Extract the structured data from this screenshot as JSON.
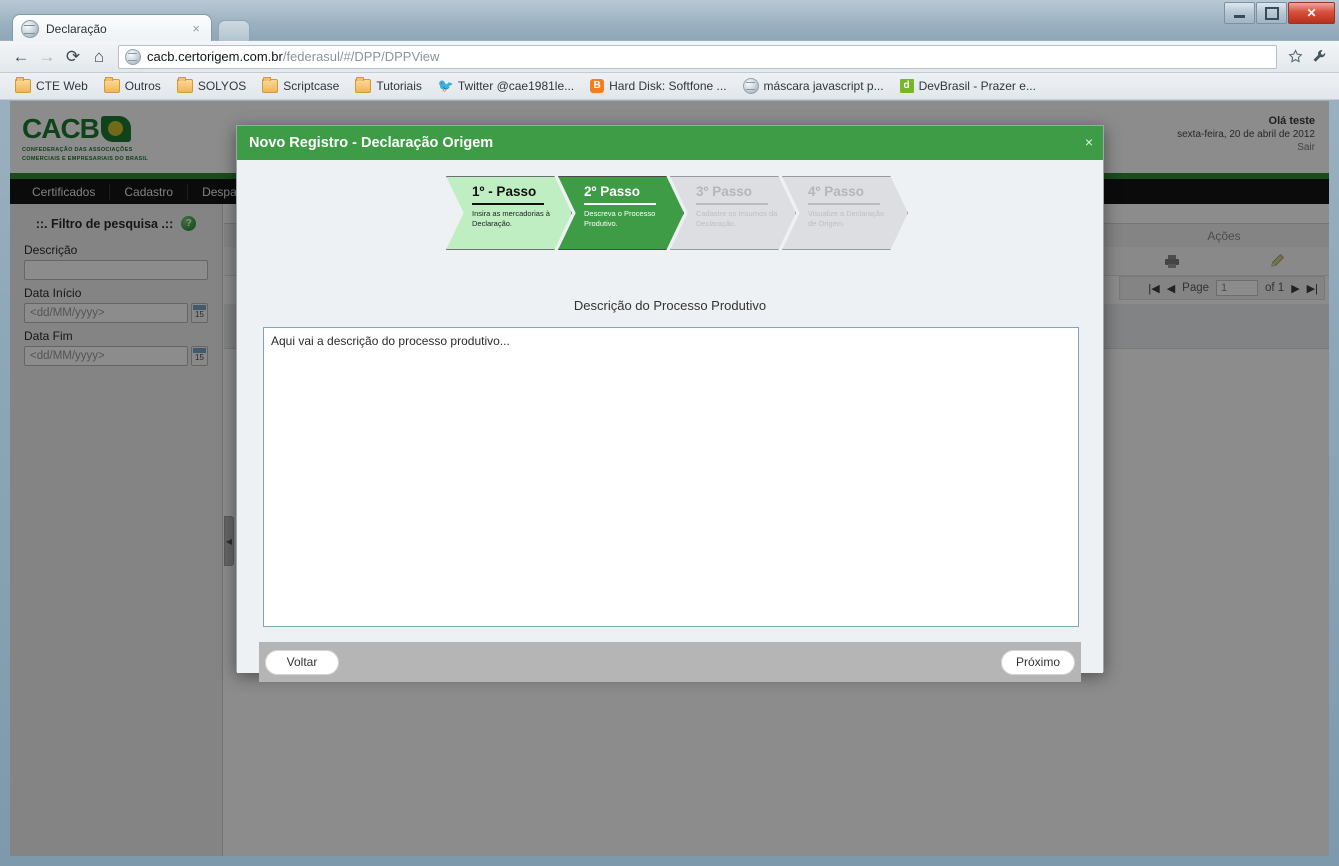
{
  "browser": {
    "tab": {
      "title": "Declaração",
      "close_label": "×",
      "favicon": "globe-icon"
    },
    "window_controls": {
      "minimize": "–",
      "maximize": "❐",
      "close": "✕"
    },
    "nav": {
      "back": "←",
      "forward": "→",
      "reload": "⟳",
      "home": "⌂"
    },
    "omnibox": {
      "host": "cacb.certorigem.com.br",
      "path": "/federasul/#/DPP/DPPView",
      "star": "☆",
      "wrench": "🔧"
    },
    "bookmarks": [
      {
        "label": "CTE Web",
        "icon": "folder-icon"
      },
      {
        "label": "Outros",
        "icon": "folder-icon"
      },
      {
        "label": "SOLYOS",
        "icon": "folder-icon"
      },
      {
        "label": "Scriptcase",
        "icon": "folder-icon"
      },
      {
        "label": "Tutoriais",
        "icon": "folder-icon"
      },
      {
        "label": "Twitter @cae1981le...",
        "icon": "twitter-icon"
      },
      {
        "label": "Hard Disk: Softfone ...",
        "icon": "blogger-icon"
      },
      {
        "label": "máscara javascript p...",
        "icon": "globe-icon"
      },
      {
        "label": "DevBrasil - Prazer e...",
        "icon": "devbrasil-icon"
      }
    ]
  },
  "app": {
    "logo": {
      "word": "CACB",
      "sub_line1": "CONFEDERAÇÃO DAS ASSOCIAÇÕES",
      "sub_line2": "COMERCIAIS E EMPRESARIAIS DO BRASIL"
    },
    "user": {
      "greeting": "Olá teste",
      "date": "sexta-feira, 20 de abril de 2012",
      "logout": "Sair"
    },
    "nav_items": [
      {
        "label": "Certificados"
      },
      {
        "label": "Cadastro"
      },
      {
        "label": "Despachantes"
      }
    ],
    "page_title": "Declaração",
    "sidebar": {
      "filter_title": "::. Filtro de pesquisa .::",
      "help": "?",
      "fields": [
        {
          "label": "Descrição",
          "value": "",
          "placeholder": ""
        },
        {
          "label": "Data Início",
          "value": "",
          "placeholder": "<dd/MM/yyyy>",
          "calendar": "15"
        },
        {
          "label": "Data Fim",
          "value": "",
          "placeholder": "<dd/MM/yyyy>",
          "calendar": "15"
        }
      ],
      "collapse": "◀"
    },
    "grid": {
      "actions_header": "Ações",
      "print_icon": "printer-icon",
      "edit_icon": "pencil-icon",
      "pager": {
        "first": "|◀",
        "prev": "◀",
        "label": "Page",
        "value": "1",
        "of": "of 1",
        "next": "▶",
        "last": "▶|"
      }
    }
  },
  "modal": {
    "title": "Novo Registro - Declaração Origem",
    "close": "×",
    "steps": [
      {
        "label": "1º - Passo",
        "desc": "Insira as mercadorias à Declaração.",
        "state": "done"
      },
      {
        "label": "2º Passo",
        "desc": "Descreva o Processo Produtivo.",
        "state": "active"
      },
      {
        "label": "3º Passo",
        "desc": "Cadastre os Insumos da Declaração.",
        "state": "todo"
      },
      {
        "label": "4º Passo",
        "desc": "Visualize a Declaração de Origem",
        "state": "todo"
      }
    ],
    "description_label": "Descrição do Processo Produtivo",
    "textarea": {
      "value": "",
      "placeholder": "Aqui vai a descrição do processo produtivo..."
    },
    "footer": {
      "back": "Voltar",
      "next": "Próximo"
    }
  },
  "colors": {
    "brand_green": "#3d9c45",
    "nav_black": "#151515",
    "step_done": "#bfeec2",
    "step_todo": "#dcdee1",
    "textarea_border": "#7fa7b9"
  }
}
